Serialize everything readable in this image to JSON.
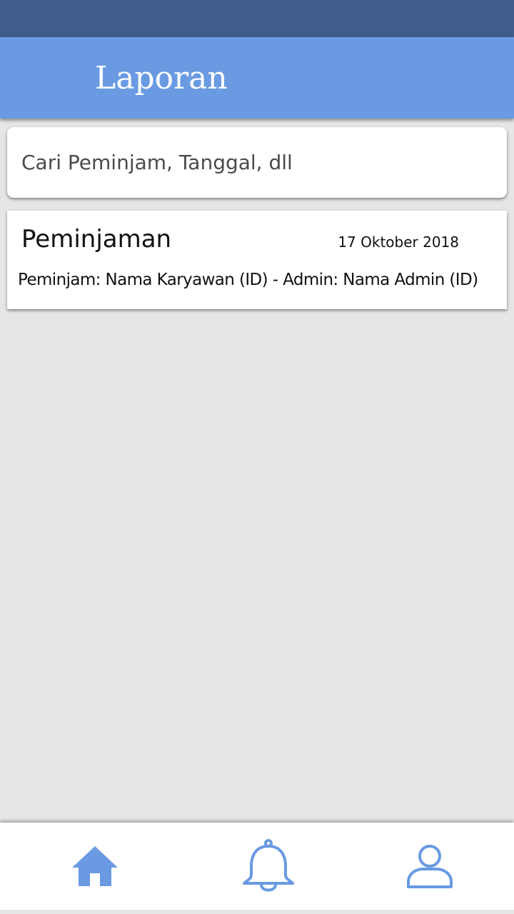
{
  "header": {
    "title": "Laporan"
  },
  "search": {
    "placeholder": "Cari Peminjam, Tanggal, dll"
  },
  "reports": [
    {
      "title": "Peminjaman",
      "date": "17 Oktober 2018",
      "detail": "Peminjam: Nama Karyawan (ID) - Admin: Nama Admin (ID)"
    }
  ],
  "bottom_nav": {
    "items": [
      {
        "icon": "home-icon"
      },
      {
        "icon": "bell-icon"
      },
      {
        "icon": "user-icon"
      }
    ]
  },
  "colors": {
    "status_bar": "#3e5d8c",
    "app_bar": "#6a9ae2",
    "background": "#e6e6e6",
    "accent_icon": "#6a9ae2"
  }
}
